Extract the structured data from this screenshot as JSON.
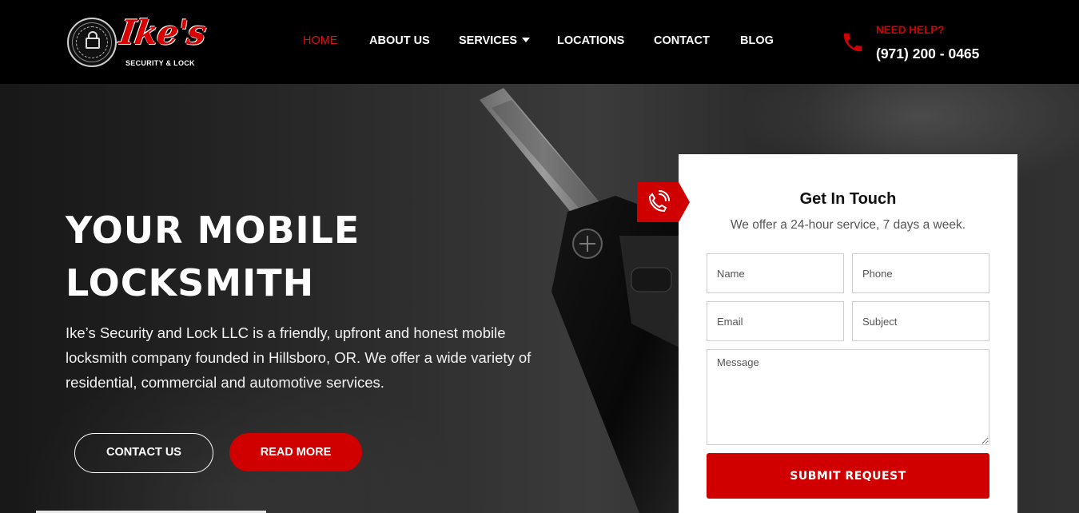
{
  "logo": {
    "brand": "Ike's",
    "tagline": "SECURITY & LOCK",
    "seal_text": "RESIDENTIAL · COMMERCIAL · AUTOMOTIVE"
  },
  "nav": {
    "items": [
      {
        "label": "HOME",
        "active": true
      },
      {
        "label": "ABOUT US",
        "active": false
      },
      {
        "label": "SERVICES",
        "active": false,
        "has_dropdown": true
      },
      {
        "label": "LOCATIONS",
        "active": false
      },
      {
        "label": "CONTACT",
        "active": false
      },
      {
        "label": "BLOG",
        "active": false
      }
    ]
  },
  "help": {
    "label": "NEED HELP?",
    "phone": "(971) 200 - 0465",
    "icon": "phone-icon"
  },
  "hero": {
    "title_line1": "YOUR MOBILE",
    "title_line2": "LOCKSMITH",
    "description": "Ike’s Security and Lock LLC is a friendly, upfront and honest mobile locksmith company founded in Hillsboro, OR. We offer a wide variety of residential, commercial and automotive services.",
    "contact_button": "CONTACT US",
    "read_more_button": "READ MORE"
  },
  "form": {
    "title": "Get In Touch",
    "subtitle": "We offer a 24-hour service, 7 days a week.",
    "name_placeholder": "Name",
    "phone_placeholder": "Phone",
    "email_placeholder": "Email",
    "subject_placeholder": "Subject",
    "message_placeholder": "Message",
    "submit_label": "SUBMIT REQUEST",
    "badge_icon": "phone-ringing-icon"
  },
  "colors": {
    "accent": "#d00000",
    "header_bg": "#000000",
    "text_light": "#ffffff"
  }
}
